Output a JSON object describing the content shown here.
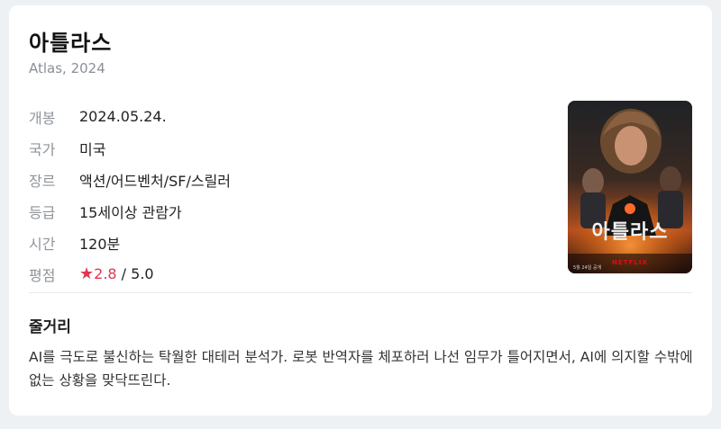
{
  "movie": {
    "title": "아틀라스",
    "subtitle": "Atlas, 2024"
  },
  "info": {
    "release": {
      "label": "개봉",
      "value": "2024.05.24."
    },
    "country": {
      "label": "국가",
      "value": "미국"
    },
    "genre": {
      "label": "장르",
      "value": "액션/어드벤처/SF/스릴러"
    },
    "rating_class": {
      "label": "등급",
      "value": "15세이상 관람가"
    },
    "runtime": {
      "label": "시간",
      "value": "120분"
    },
    "score": {
      "label": "평점",
      "star": "★",
      "value": "2.8",
      "max": " / 5.0"
    }
  },
  "poster": {
    "title_text": "아틀라스",
    "brand": "NETFLIX",
    "date_text": "5월 24일 공개"
  },
  "plot": {
    "heading": "줄거리",
    "text": "AI를 극도로 불신하는 탁월한 대테러 분석가. 로봇 반역자를 체포하러 나선 임무가 틀어지면서, AI에 의지할 수밖에 없는 상황을 맞닥뜨린다."
  },
  "colors": {
    "accent_star": "#e0364e",
    "label_gray": "#8f949a"
  }
}
